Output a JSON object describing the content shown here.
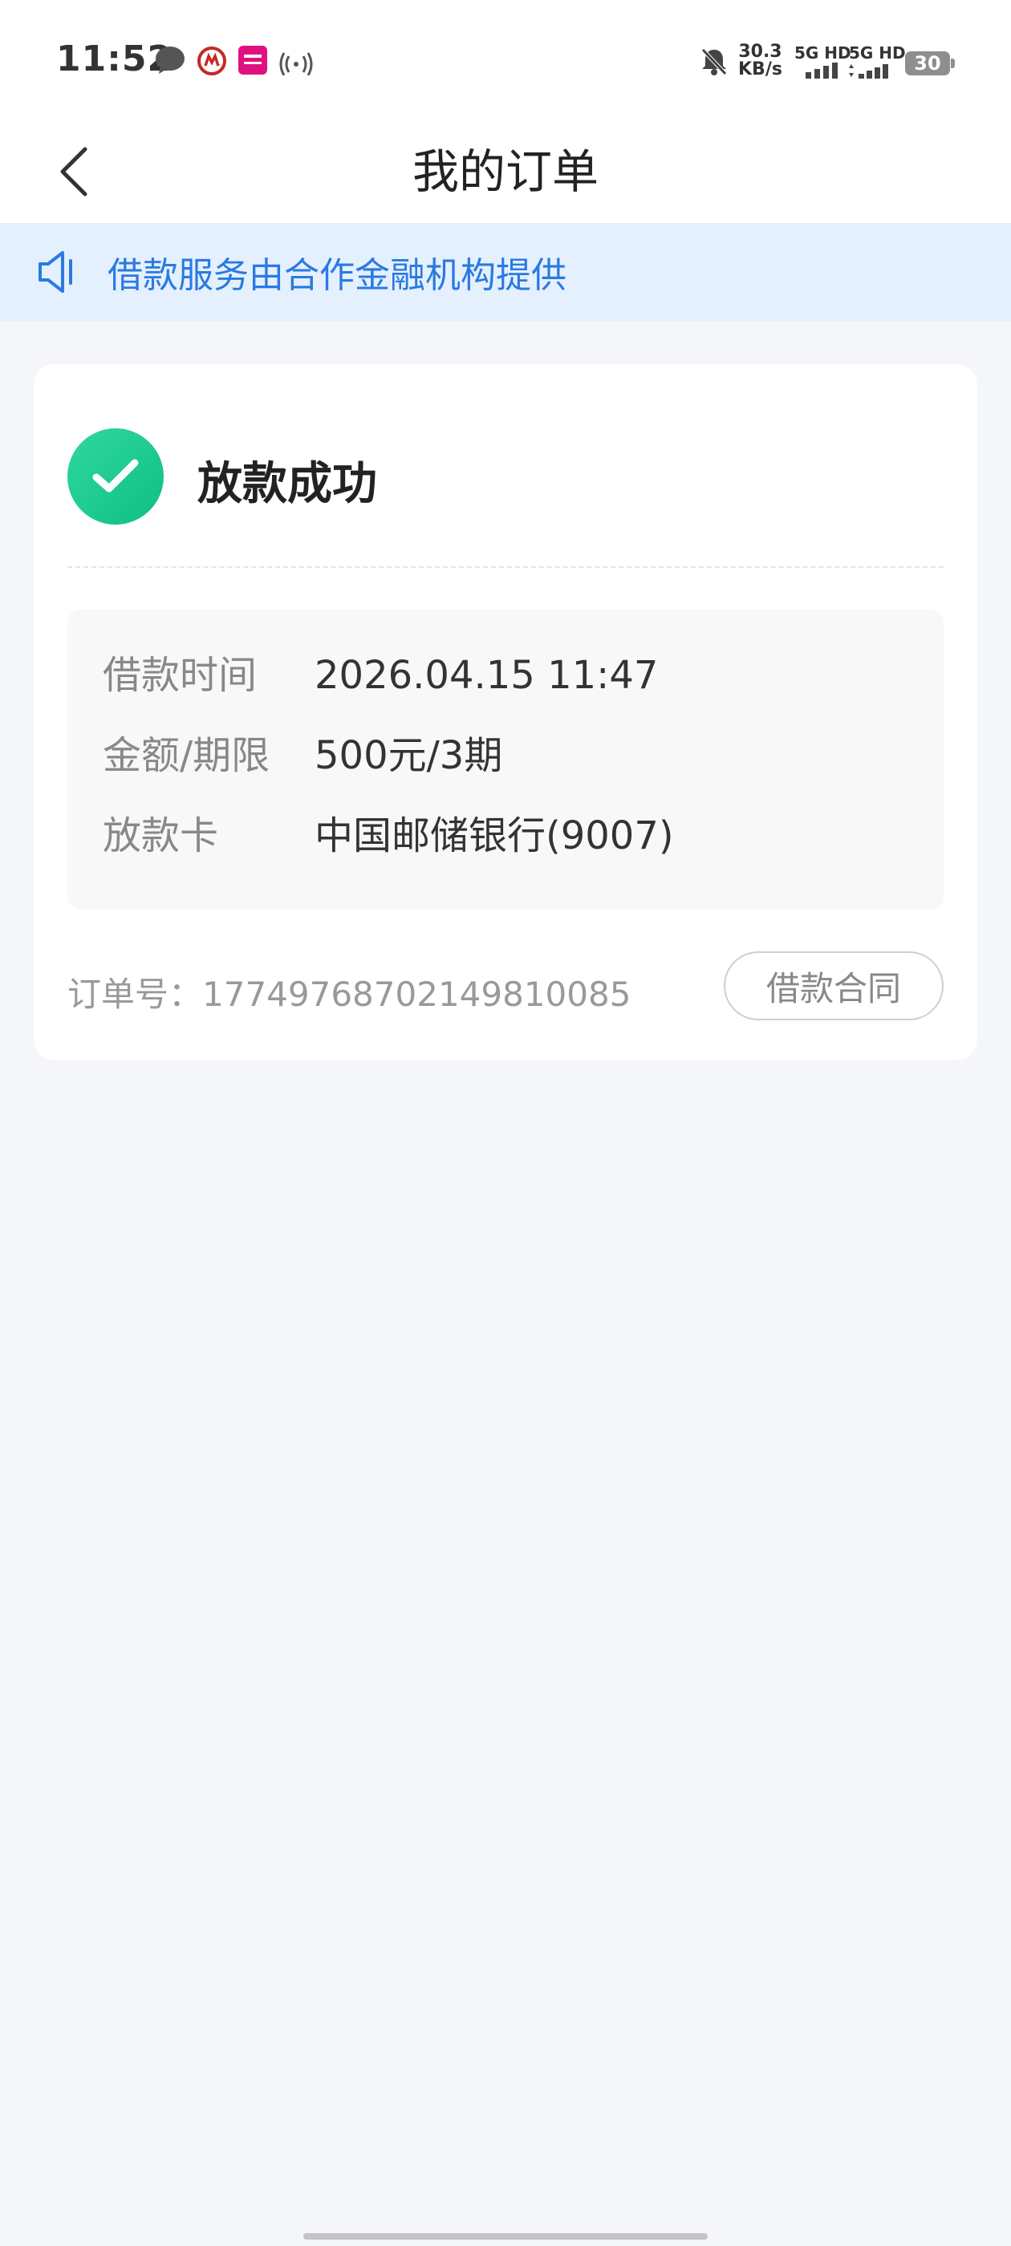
{
  "status_bar": {
    "time": "11:52",
    "net_speed_value": "30.3",
    "net_speed_unit": "KB/s",
    "signal1_label": "5G HD",
    "signal2_label": "5G HD",
    "battery": "30",
    "icons": [
      "message-icon",
      "bank-app-icon",
      "vip-app-icon",
      "hotspot-icon",
      "mute-bell-icon"
    ]
  },
  "nav": {
    "title": "我的订单"
  },
  "notice": {
    "text": "借款服务由合作金融机构提供"
  },
  "order": {
    "status": "放款成功",
    "status_color": "#17c98f",
    "details": [
      {
        "label": "借款时间",
        "value": "2026.04.15 11:47"
      },
      {
        "label": "金额/期限",
        "value": "500元/3期"
      },
      {
        "label": "放款卡",
        "value": "中国邮储银行(9007)"
      }
    ],
    "order_number_text": "订单号：17749768702149810085",
    "contract_button": "借款合同"
  },
  "colors": {
    "accent": "#2a7ae2",
    "notice_bg": "#e4f0fd",
    "page_bg": "#f4f6f9"
  }
}
